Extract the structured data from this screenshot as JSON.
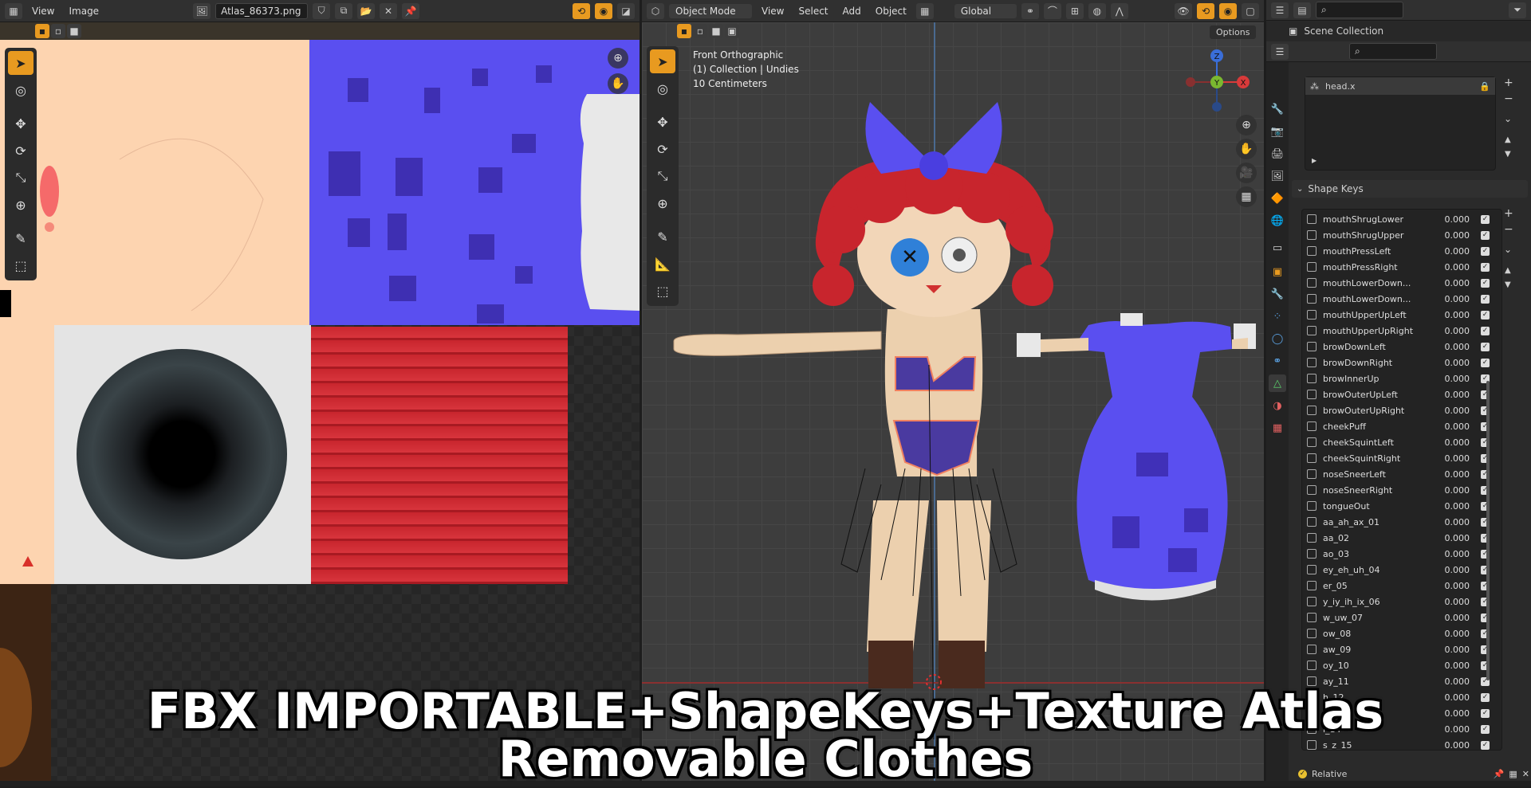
{
  "image_editor": {
    "menu": [
      "View",
      "Image"
    ],
    "image_name": "Atlas_86373.png"
  },
  "viewport": {
    "mode": "Object Mode",
    "menu": [
      "View",
      "Select",
      "Add",
      "Object"
    ],
    "orientation": "Global",
    "options_label": "Options",
    "info_line1": "Front Orthographic",
    "info_line2": "(1) Collection | Undies",
    "info_line3": "10 Centimeters",
    "gizmo_axes": {
      "z": "Z",
      "y": "Y",
      "x": "X"
    }
  },
  "outliner": {
    "scene_collection": "Scene Collection"
  },
  "properties": {
    "vertex_group": "head.x",
    "shape_keys_title": "Shape Keys",
    "relative_label": "Relative",
    "shape_keys": [
      {
        "name": "mouthShrugLower",
        "value": "0.000"
      },
      {
        "name": "mouthShrugUpper",
        "value": "0.000"
      },
      {
        "name": "mouthPressLeft",
        "value": "0.000"
      },
      {
        "name": "mouthPressRight",
        "value": "0.000"
      },
      {
        "name": "mouthLowerDown...",
        "value": "0.000"
      },
      {
        "name": "mouthLowerDown...",
        "value": "0.000"
      },
      {
        "name": "mouthUpperUpLeft",
        "value": "0.000"
      },
      {
        "name": "mouthUpperUpRight",
        "value": "0.000"
      },
      {
        "name": "browDownLeft",
        "value": "0.000"
      },
      {
        "name": "browDownRight",
        "value": "0.000"
      },
      {
        "name": "browInnerUp",
        "value": "0.000"
      },
      {
        "name": "browOuterUpLeft",
        "value": "0.000"
      },
      {
        "name": "browOuterUpRight",
        "value": "0.000"
      },
      {
        "name": "cheekPuff",
        "value": "0.000"
      },
      {
        "name": "cheekSquintLeft",
        "value": "0.000"
      },
      {
        "name": "cheekSquintRight",
        "value": "0.000"
      },
      {
        "name": "noseSneerLeft",
        "value": "0.000"
      },
      {
        "name": "noseSneerRight",
        "value": "0.000"
      },
      {
        "name": "tongueOut",
        "value": "0.000"
      },
      {
        "name": "aa_ah_ax_01",
        "value": "0.000"
      },
      {
        "name": "aa_02",
        "value": "0.000"
      },
      {
        "name": "ao_03",
        "value": "0.000"
      },
      {
        "name": "ey_eh_uh_04",
        "value": "0.000"
      },
      {
        "name": "er_05",
        "value": "0.000"
      },
      {
        "name": "y_iy_ih_ix_06",
        "value": "0.000"
      },
      {
        "name": "w_uw_07",
        "value": "0.000"
      },
      {
        "name": "ow_08",
        "value": "0.000"
      },
      {
        "name": "aw_09",
        "value": "0.000"
      },
      {
        "name": "oy_10",
        "value": "0.000"
      },
      {
        "name": "ay_11",
        "value": "0.000"
      },
      {
        "name": "h_12",
        "value": "0.000"
      },
      {
        "name": "r_13",
        "value": "0.000"
      },
      {
        "name": "l_14",
        "value": "0.000"
      },
      {
        "name": "s_z_15",
        "value": "0.000"
      }
    ]
  },
  "overlay": {
    "line1": "FBX IMPORTABLE+ShapeKeys+Texture Atlas",
    "line2": "Removable Clothes"
  },
  "colors": {
    "accent": "#e89a20",
    "skin": "#fdd4b0",
    "normal_map": "#5a4ff0",
    "yarn": "#c8252d"
  }
}
